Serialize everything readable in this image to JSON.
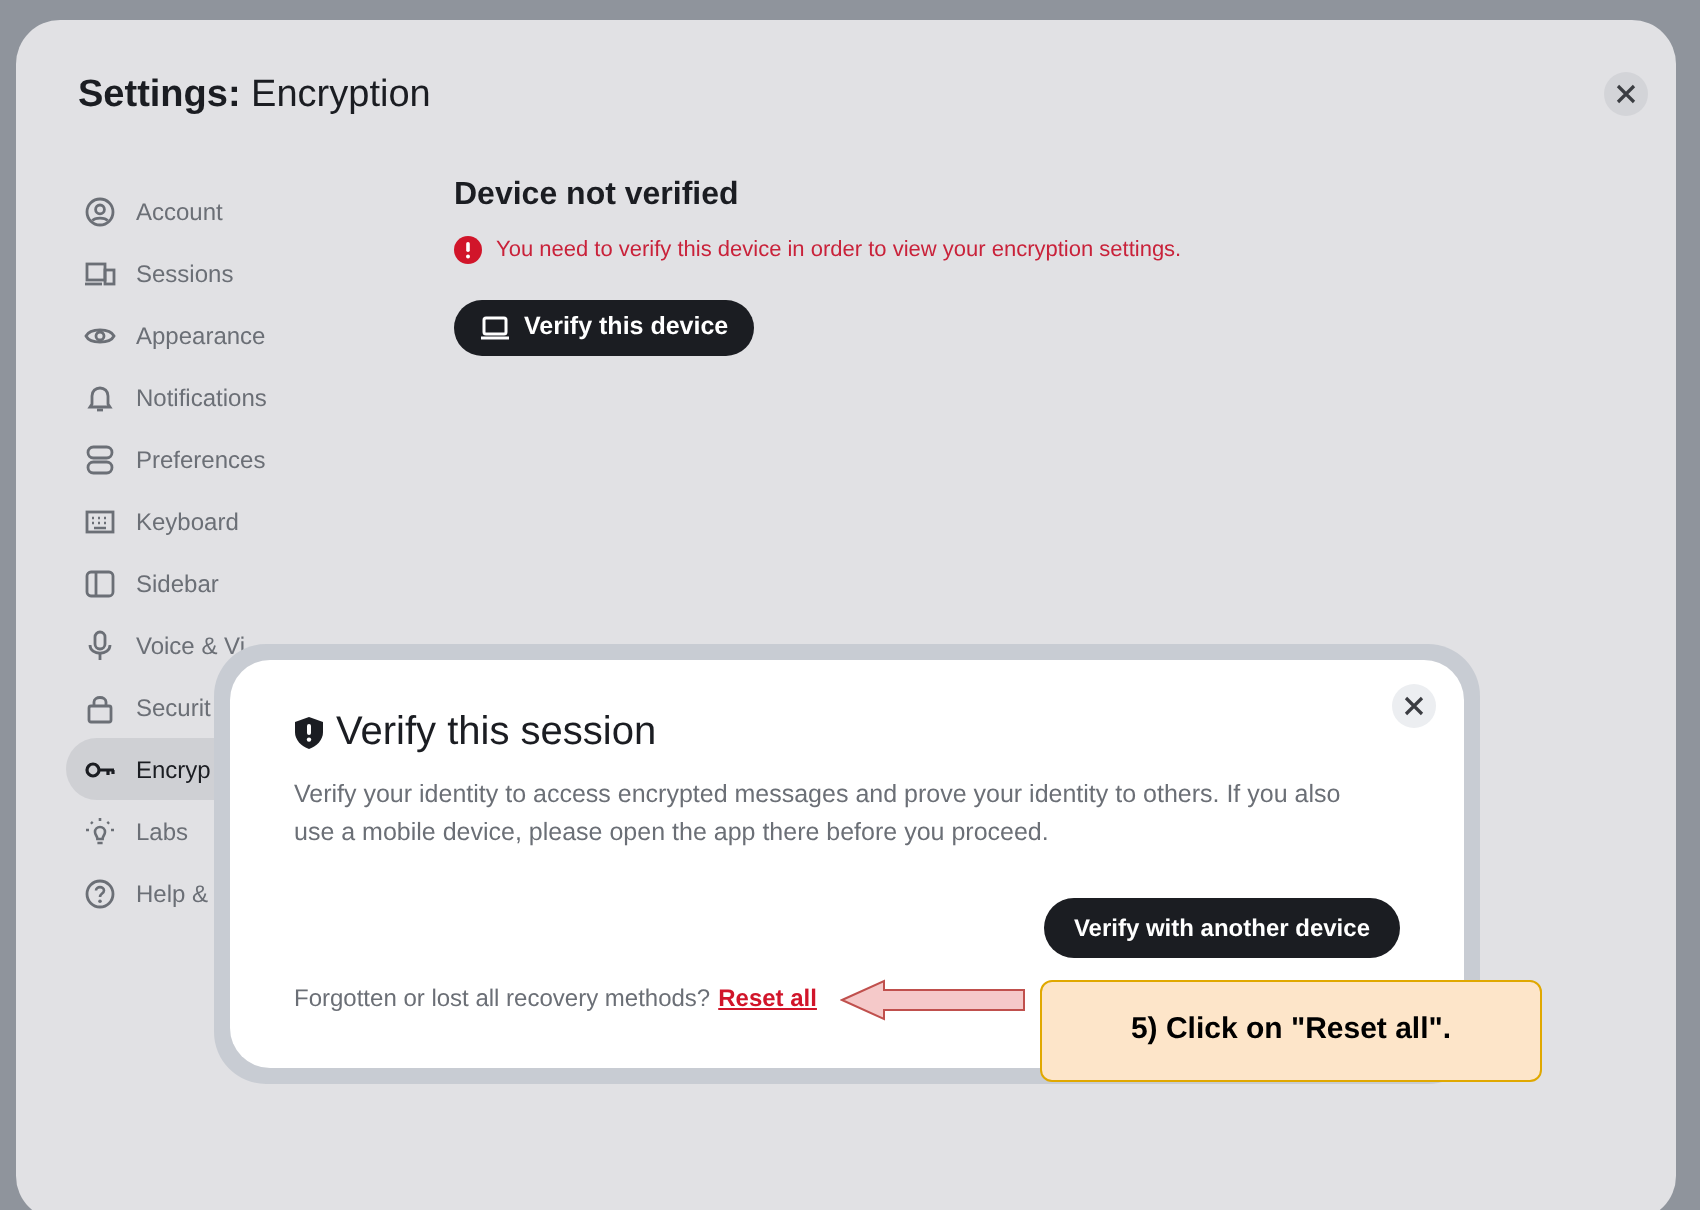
{
  "window": {
    "title": "**Settings:** Encryption"
  },
  "sidebar": {
    "items": [
      {
        "label": "Account",
        "selected": false
      },
      {
        "label": "Sessions",
        "selected": false
      },
      {
        "label": "Appearance",
        "selected": false
      },
      {
        "label": "Notifications",
        "selected": false
      },
      {
        "label": "Preferences",
        "selected": false
      },
      {
        "label": "Keyboard",
        "selected": false
      },
      {
        "label": "Sidebar",
        "selected": false
      },
      {
        "label": "Voice & Vi",
        "selected": false
      },
      {
        "label": "Securit",
        "selected": false
      },
      {
        "label": "Encryp",
        "selected": true
      },
      {
        "label": "Labs",
        "selected": false
      },
      {
        "label": "Help &",
        "selected": false
      }
    ]
  },
  "main": {
    "heading": "Device not verified",
    "error": "You need to verify this device in order to view your encryption settings.",
    "button": "Verify this device"
  },
  "dialog": {
    "title": "Verify this session",
    "body": "Verify your identity to access encrypted messages and prove your identity to others. If you also use a mobile device, please open the app there before you proceed.",
    "button": "Verify with another device",
    "footer_text": "Forgotten or lost all recovery methods?",
    "link": "Reset all"
  },
  "annotation": {
    "text": "5) Click on \"Reset all\"."
  }
}
